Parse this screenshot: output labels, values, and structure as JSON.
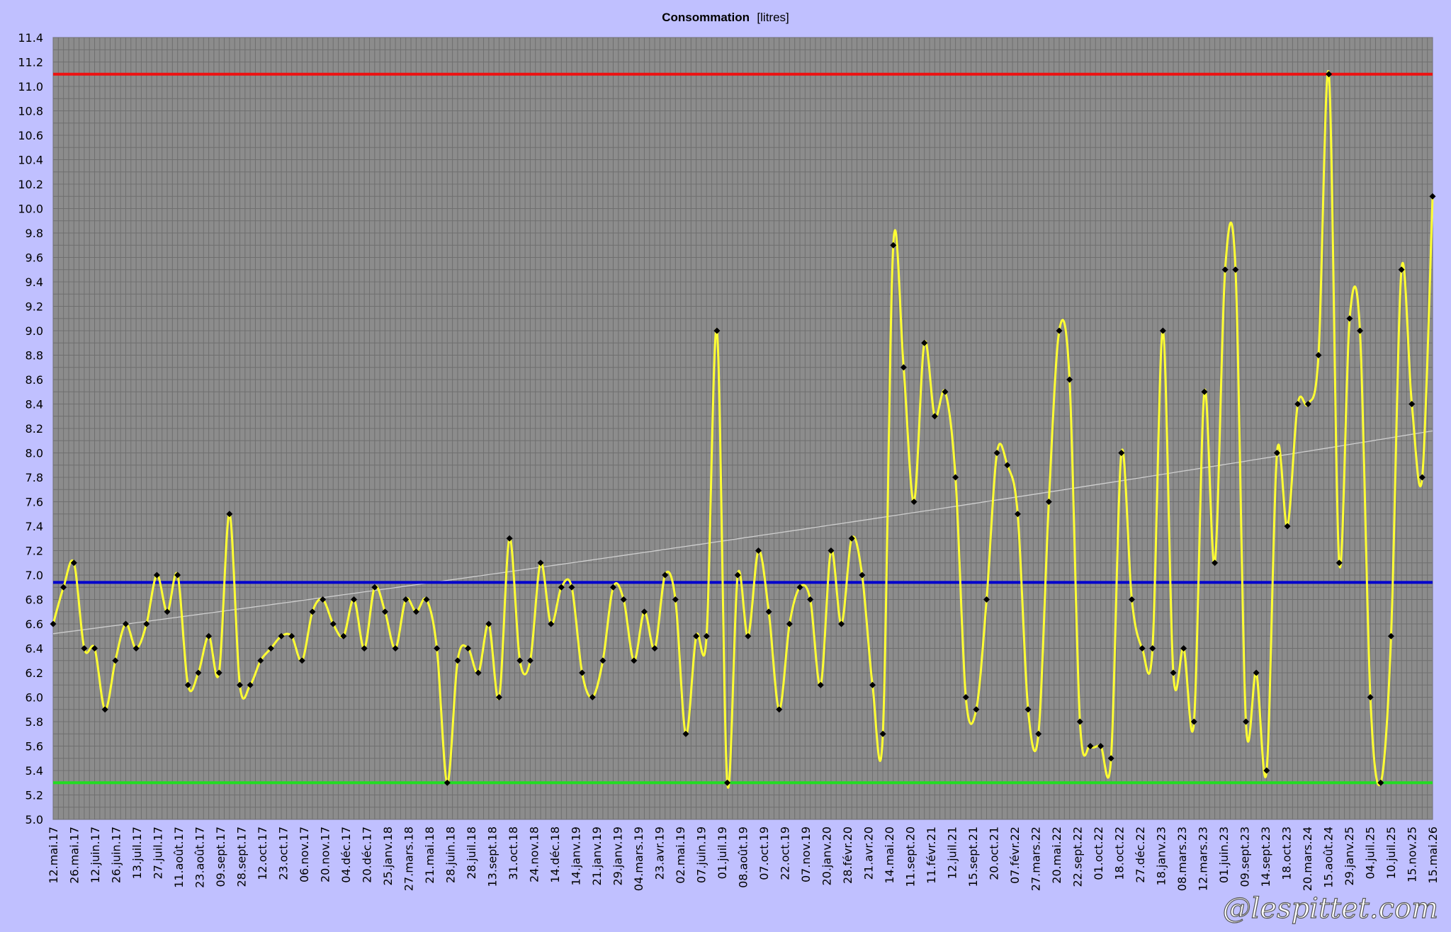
{
  "chart_data": {
    "type": "line",
    "title": "Consommation",
    "unit": "[litres]",
    "ylim": [
      5.0,
      11.4
    ],
    "yticks": [
      "5.0",
      "5.2",
      "5.4",
      "5.6",
      "5.8",
      "6.0",
      "6.2",
      "6.4",
      "6.6",
      "6.8",
      "7.0",
      "7.2",
      "7.4",
      "7.6",
      "7.8",
      "8.0",
      "8.2",
      "8.4",
      "8.6",
      "8.8",
      "9.0",
      "9.2",
      "9.4",
      "9.6",
      "9.8",
      "10.0",
      "10.2",
      "10.4",
      "10.6",
      "10.8",
      "11.0",
      "11.2",
      "11.4"
    ],
    "xticks": [
      "12.mai.17",
      "26.mai.17",
      "12.juin.17",
      "26.juin.17",
      "13.juil.17",
      "27.juil.17",
      "11.août.17",
      "23.août.17",
      "09.sept.17",
      "28.sept.17",
      "12.oct.17",
      "23.oct.17",
      "06.nov.17",
      "20.nov.17",
      "04.déc.17",
      "20.déc.17",
      "25.janv.18",
      "27.mars.18",
      "21.mai.18",
      "28.juin.18",
      "28.juil.18",
      "13.sept.18",
      "31.oct.18",
      "24.nov.18",
      "14.déc.18",
      "14.janv.19",
      "21.janv.19",
      "29.janv.19",
      "04.mars.19",
      "23.avr.19",
      "02.mai.19",
      "07.juin.19",
      "01.juil.19",
      "08.août.19",
      "07.oct.19",
      "22.oct.19",
      "07.nov.19",
      "20.janv.20",
      "28.févr.20",
      "21.avr.20",
      "14.mai.20",
      "11.sept.20",
      "11.févr.21",
      "12.juil.21",
      "15.sept.21",
      "20.oct.21",
      "07.févr.22",
      "27.mars.22",
      "20.mai.22",
      "22.sept.22",
      "01.oct.22",
      "18.oct.22",
      "27.déc.22",
      "18.janv.23",
      "08.mars.23",
      "12.mars.23",
      "01.juin.23",
      "09.sept.23",
      "14.sept.23",
      "18.oct.23",
      "20.mars.24",
      "15.août.24",
      "29.janv.25",
      "04.juil.25",
      "10.juil.25",
      "15.nov.25",
      "15.mai.26"
    ],
    "series": [
      {
        "values": [
          6.6,
          6.9,
          7.1,
          6.4,
          6.4,
          5.9,
          6.3,
          6.6,
          6.4,
          6.6,
          7.0,
          6.7,
          7.0,
          6.1,
          6.2,
          6.5,
          6.2,
          7.5,
          6.1,
          6.1,
          6.3,
          6.4,
          6.5,
          6.5,
          6.3,
          6.7,
          6.8,
          6.6,
          6.5,
          6.8,
          6.4,
          6.9,
          6.7,
          6.4,
          6.8,
          6.7,
          6.8,
          6.4,
          5.3,
          6.3,
          6.4,
          6.2,
          6.6,
          6.0,
          7.3,
          6.3,
          6.3,
          7.1,
          6.6,
          6.9,
          6.9,
          6.2,
          6.0,
          6.3,
          6.9,
          6.8,
          6.3,
          6.7,
          6.4,
          7.0,
          6.8,
          5.7,
          6.5,
          6.5,
          9.0,
          5.3,
          7.0,
          6.5,
          7.2,
          6.7,
          5.9,
          6.6,
          6.9,
          6.8,
          6.1,
          7.2,
          6.6,
          7.3,
          7.0,
          6.1,
          5.7,
          9.7,
          8.7,
          7.6,
          8.9,
          8.3,
          8.5,
          7.8,
          6.0,
          5.9,
          6.8,
          8.0,
          7.9,
          7.5,
          5.9,
          5.7,
          7.6,
          9.0,
          8.6,
          5.8,
          5.6,
          5.6,
          5.5,
          8.0,
          6.8,
          6.4,
          6.4,
          9.0,
          6.2,
          6.4,
          5.8,
          8.5,
          7.1,
          9.5,
          9.5,
          5.8,
          6.2,
          5.4,
          8.0,
          7.4,
          8.4,
          8.4,
          8.8,
          11.1,
          7.1,
          9.1,
          9.0,
          6.0,
          5.3,
          6.5,
          9.5,
          8.4,
          7.8,
          10.1
        ],
        "color": "#ffff33",
        "marker_color": "#000000"
      }
    ],
    "reference_lines": [
      {
        "value": 11.1,
        "color": "#ee1111"
      },
      {
        "value": 6.94,
        "color": "#0000cc"
      },
      {
        "value": 5.3,
        "color": "#22dd22"
      }
    ],
    "trend": {
      "type": "exponential",
      "start": 6.52,
      "end": 8.18,
      "color": "#cfcfcf"
    },
    "grid": true,
    "plot_background": "#8c8c8c",
    "page_background": "#c0c0ff",
    "watermark": "@lespittet.com"
  }
}
